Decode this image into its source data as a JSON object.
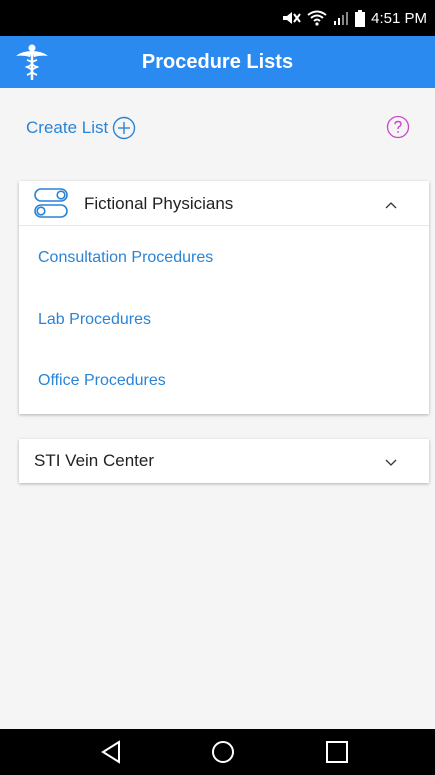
{
  "status_bar": {
    "time": "4:51 PM",
    "icons": [
      "mute-icon",
      "wifi-icon",
      "signal-icon",
      "battery-icon"
    ]
  },
  "app_bar": {
    "title": "Procedure Lists",
    "logo_icon": "caduceus-icon",
    "background_color": "#2a8af0"
  },
  "toolbar": {
    "create_list_label": "Create List",
    "create_list_icon": "plus-circle-icon",
    "help_icon": "question-circle-icon"
  },
  "groups": [
    {
      "title": "Fictional Physicians",
      "icon": "toggle-icon",
      "expanded": true,
      "items": [
        {
          "label": "Consultation Procedures"
        },
        {
          "label": "Lab Procedures"
        },
        {
          "label": "Office Procedures"
        }
      ]
    },
    {
      "title": "STI Vein Center",
      "expanded": false,
      "items": []
    }
  ],
  "nav_bar": {
    "buttons": [
      "back-icon",
      "home-icon",
      "recent-apps-icon"
    ]
  },
  "colors": {
    "accent": "#2a84d6",
    "help": "#cc44cc",
    "background": "#f5f5f5"
  }
}
